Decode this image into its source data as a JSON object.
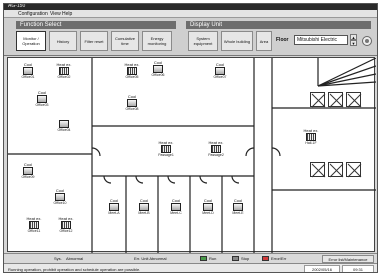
{
  "window": {
    "title": "AG-150"
  },
  "menu": {
    "items": [
      "Configuration",
      "View",
      "Help"
    ]
  },
  "function_select": {
    "header": "Function Select",
    "buttons": [
      {
        "label": "Monitor / Operation",
        "active": true
      },
      {
        "label": "History",
        "active": false
      },
      {
        "label": "Filter reset",
        "active": false
      },
      {
        "label": "Cumulative time",
        "active": false
      },
      {
        "label": "Energy monitoring",
        "active": false
      }
    ]
  },
  "display_unit": {
    "header": "Display Unit",
    "buttons": [
      "System equipment",
      "Whole building",
      "Area"
    ],
    "floor_label": "Floor",
    "floor_value": "Mitsubishi Electric",
    "spin_up": "▲",
    "spin_down": "▼"
  },
  "units": [
    {
      "label": "Cool",
      "name": "Office01",
      "type": "ac"
    },
    {
      "label": "Heat ex.",
      "name": "Office02",
      "type": "hx"
    },
    {
      "label": "Cool",
      "name": "Office03",
      "type": "ac"
    },
    {
      "label": "",
      "name": "Office04",
      "type": "ac"
    },
    {
      "label": "Heat ex.",
      "name": "Office05",
      "type": "hx"
    },
    {
      "label": "Cool",
      "name": "Office06",
      "type": "ac"
    },
    {
      "label": "Cool",
      "name": "Office07",
      "type": "ac"
    },
    {
      "label": "Cool",
      "name": "Office08",
      "type": "ac"
    },
    {
      "label": "Heat ex.",
      "name": "Passage1",
      "type": "hx"
    },
    {
      "label": "Heat ex.",
      "name": "Passage2",
      "type": "hx"
    },
    {
      "label": "Heat ex.",
      "name": "Hall-1F",
      "type": "hx"
    },
    {
      "label": "Cool",
      "name": "Office09",
      "type": "ac"
    },
    {
      "label": "Cool",
      "name": "Office10",
      "type": "ac"
    },
    {
      "label": "Heat ex.",
      "name": "Office11",
      "type": "hx"
    },
    {
      "label": "Heat ex.",
      "name": "Office12",
      "type": "hx"
    },
    {
      "label": "Cool",
      "name": "Meet-A",
      "type": "ac"
    },
    {
      "label": "Cool",
      "name": "Meet-B",
      "type": "ac"
    },
    {
      "label": "Cool",
      "name": "Meet-C",
      "type": "ac"
    },
    {
      "label": "Cool",
      "name": "Meet-D",
      "type": "ac"
    },
    {
      "label": "Cool",
      "name": "Meet-E",
      "type": "ac"
    }
  ],
  "status_row": {
    "system_status": "Abnormal",
    "system_label": "Sys.",
    "errunit_label": "Err. Unit Abnormal",
    "legend": [
      {
        "label": "Run",
        "color": "#4a9a4a"
      },
      {
        "label": "Stop",
        "color": "#888888"
      },
      {
        "label": "Error/Err",
        "color": "#d23b3b"
      }
    ],
    "fault_button": "Error list/Maintenance"
  },
  "statusbar": {
    "message": "Running operation, prohibit operation and schedule operation are possible.",
    "date": "2002/05/16",
    "time": "09:31"
  }
}
